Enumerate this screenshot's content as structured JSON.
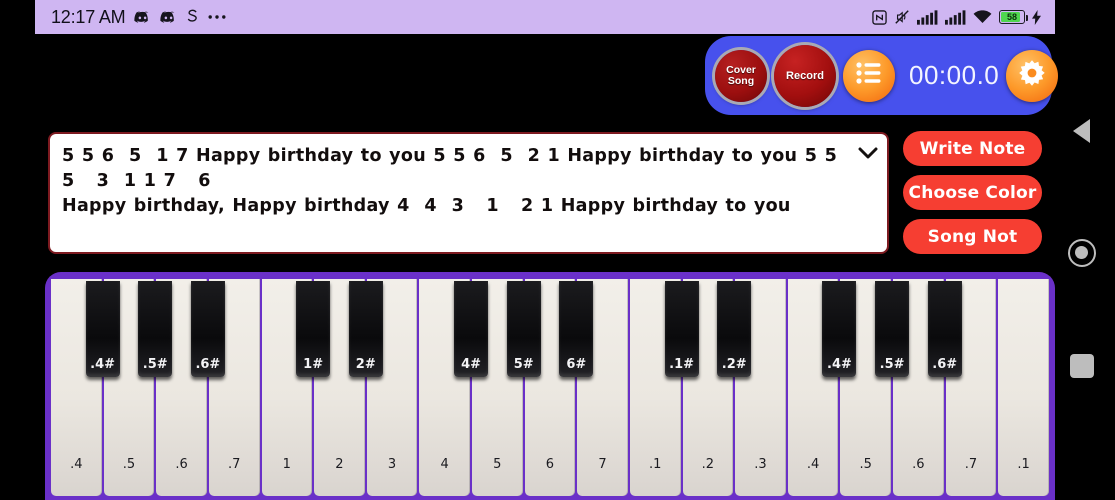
{
  "status_bar": {
    "clock": "12:17 AM",
    "left_icons": [
      "discord-icon",
      "discord-icon",
      "snapchat-icon",
      "more-dots-icon"
    ],
    "right_icons": [
      "nfc-icon",
      "mute-icon",
      "signal-icon",
      "signal-2-icon",
      "wifi-icon"
    ],
    "battery_percent": "58",
    "charging_icon": "bolt-icon",
    "bg_color": "#cfb6f2"
  },
  "control_bar": {
    "cover_song_label_line1": "Cover",
    "cover_song_label_line2": "Song",
    "record_label": "Record",
    "list_icon": "list-icon",
    "timer": "00:00.0",
    "settings_icon": "gear-icon",
    "bg_color": "#4751ed"
  },
  "note_area": {
    "text": "5 5 6  5  1 7 Happy birthday to you 5 5 6  5  2 1 Happy birthday to you 5 5 5   3  1 1 7   6\nHappy birthday, Happy birthday 4  4  3   1   2 1 Happy birthday to you",
    "dropdown_icon": "chevron-down-icon",
    "border_color": "#7d1a20"
  },
  "actions": {
    "accent_color": "#f63e32",
    "buttons": [
      {
        "label": "Write Note",
        "name": "write-note-button"
      },
      {
        "label": "Choose Color",
        "name": "choose-color-button"
      },
      {
        "label": "Song Not",
        "name": "song-not-button"
      }
    ]
  },
  "piano": {
    "frame_color": "#6a30c8",
    "white_keys": [
      ".4",
      ".5",
      ".6",
      ".7",
      "1",
      "2",
      "3",
      "4",
      "5",
      "6",
      "7",
      ".1",
      ".2",
      ".3",
      ".4",
      ".5",
      ".6",
      ".7",
      ".1"
    ],
    "black_keys": [
      {
        "label": ".4#",
        "after_white_index": 0
      },
      {
        "label": ".5#",
        "after_white_index": 1
      },
      {
        "label": ".6#",
        "after_white_index": 2
      },
      {
        "label": "1#",
        "after_white_index": 4
      },
      {
        "label": "2#",
        "after_white_index": 5
      },
      {
        "label": "4#",
        "after_white_index": 7
      },
      {
        "label": "5#",
        "after_white_index": 8
      },
      {
        "label": "6#",
        "after_white_index": 9
      },
      {
        "label": ".1#",
        "after_white_index": 11
      },
      {
        "label": ".2#",
        "after_white_index": 12
      },
      {
        "label": ".4#",
        "after_white_index": 14
      },
      {
        "label": ".5#",
        "after_white_index": 15
      },
      {
        "label": ".6#",
        "after_white_index": 16
      }
    ]
  },
  "nav_bar": {
    "back_icon": "back-triangle-icon",
    "home_icon": "home-circle-icon",
    "recents_icon": "recents-square-icon"
  }
}
